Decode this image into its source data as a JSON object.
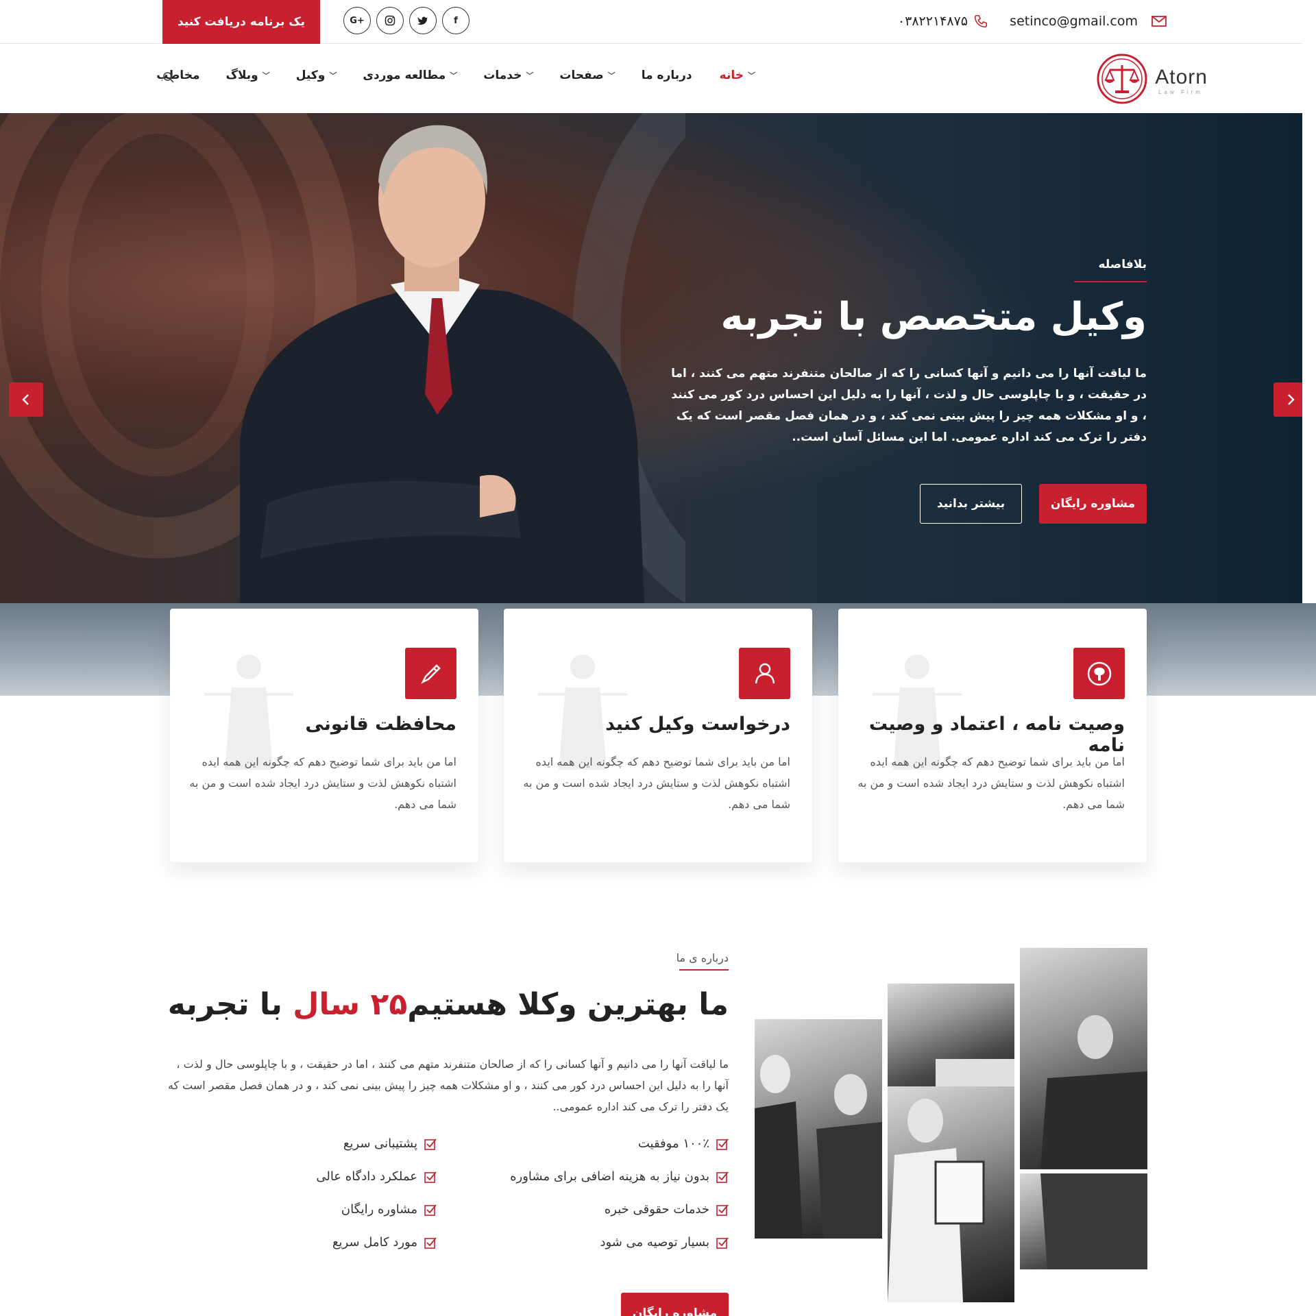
{
  "topbar": {
    "email": "setinco@gmail.com",
    "phone": "۰۳۸۲۲۱۴۸۷۵",
    "cta": "یک برنامه دریافت کنید",
    "social": [
      {
        "icon": "facebook-icon",
        "label": "f"
      },
      {
        "icon": "twitter-icon",
        "label": "t"
      },
      {
        "icon": "instagram-icon",
        "label": "◎"
      },
      {
        "icon": "google-plus-icon",
        "label": "G+"
      }
    ]
  },
  "logo": {
    "name": "Atorn",
    "tagline": "Law Firm"
  },
  "nav": {
    "items": [
      {
        "label": "خانه",
        "dropdown": true,
        "active": true
      },
      {
        "label": "درباره ما",
        "dropdown": false
      },
      {
        "label": "صفحات",
        "dropdown": true
      },
      {
        "label": "خدمات",
        "dropdown": true
      },
      {
        "label": "مطالعه موردی",
        "dropdown": true
      },
      {
        "label": "وکیل",
        "dropdown": true
      },
      {
        "label": "وبلاگ",
        "dropdown": true
      },
      {
        "label": "مخاطب",
        "dropdown": false
      }
    ]
  },
  "hero": {
    "kicker": "بلافاصله",
    "title": "وکیل متخصص با تجربه",
    "text": "ما لیاقت آنها را می دانیم و آنها کسانی را که از صالحان متنفرند متهم می کنند ، اما در حقیقت ، و با چاپلوسی حال و لذت ، آنها را به دلیل این احساس درد کور می کنند ، و او مشکلات همه چیز را پیش بینی نمی کند ، و در همان فصل مقصر است که یک دفتر را ترک می کند اداره عمومی. اما این مسائل آسان است..",
    "primary_button": "مشاوره رایگان",
    "secondary_button": "بیشتر بدانید"
  },
  "services": [
    {
      "title": "وصیت نامه ، اعتماد و وصیت نامه",
      "text": "اما من باید برای شما توضیح دهم که چگونه این همه ایده اشتباه نکوهش لذت و ستایش درد ایجاد شده است و من به شما می دهم.",
      "icon": "brain-icon"
    },
    {
      "title": "درخواست وکیل کنید",
      "text": "اما من باید برای شما توضیح دهم که چگونه این همه ایده اشتباه نکوهش لذت و ستایش درد ایجاد شده است و من به شما می دهم.",
      "icon": "lawyer-icon"
    },
    {
      "title": "محافظت قانونی",
      "text": "اما من باید برای شما توضیح دهم که چگونه این همه ایده اشتباه نکوهش لذت و ستایش درد ایجاد شده است و من به شما می دهم.",
      "icon": "pen-icon"
    }
  ],
  "about": {
    "kicker": "درباره ی ما",
    "title_pre": "ما بهترین وکلا هستیم",
    "title_highlight": "۲۵ سال",
    "title_post": "با تجربه",
    "text": "ما لیاقت آنها را می دانیم و آنها کسانی را که از صالحان متنفرند متهم می کنند ، اما در حقیقت ، و با چاپلوسی حال و لذت ، آنها را به دلیل این احساس درد کور می کنند ، و او مشکلات همه چیز را پیش بینی نمی کند ، و در همان فصل مقصر است که یک دفتر را ترک می کند اداره عمومی..",
    "features_right": [
      "۱۰۰٪ موفقیت",
      "بدون نیاز به هزینه اضافی برای مشاوره",
      "خدمات حقوقی خبره",
      "بسیار توصیه می شود"
    ],
    "features_left": [
      "پشتیبانی سریع",
      "عملکرد دادگاه عالی",
      "مشاوره رایگان",
      "مورد کامل سریع"
    ],
    "button": "مشاوره رایگان"
  },
  "colors": {
    "accent": "#c9202f",
    "hero_dark": "#102333"
  }
}
